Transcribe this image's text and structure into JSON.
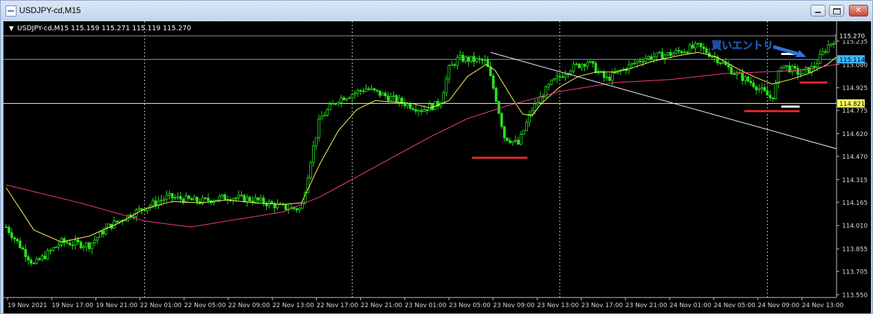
{
  "window": {
    "title": "USDJPY-cd,M15"
  },
  "chart_header": "USDJPY-cd,M15  115.159 115.271 115.119 115.270",
  "annotation": {
    "text": "買いエントリ"
  },
  "chart_data": {
    "type": "candlestick",
    "title": "USDJPY-cd,M15",
    "ylim": [
      113.55,
      115.33
    ],
    "y_ticks": [
      "115.235",
      "115.080",
      "114.925",
      "114.775",
      "114.620",
      "114.470",
      "114.315",
      "114.165",
      "114.010",
      "113.855",
      "113.705",
      "113.550"
    ],
    "x_ticks": [
      "19 Nov 2021",
      "19 Nov 17:00",
      "19 Nov 21:00",
      "22 Nov 01:00",
      "22 Nov 05:00",
      "22 Nov 09:00",
      "22 Nov 13:00",
      "22 Nov 17:00",
      "22 Nov 21:00",
      "23 Nov 01:00",
      "23 Nov 05:00",
      "23 Nov 09:00",
      "23 Nov 13:00",
      "23 Nov 17:00",
      "23 Nov 21:00",
      "24 Nov 01:00",
      "24 Nov 05:00",
      "24 Nov 09:00",
      "24 Nov 13:00"
    ],
    "last_price": "115.270",
    "h_lines": [
      {
        "price": 115.114,
        "label": "115.114",
        "color": "#3fb6ff"
      },
      {
        "price": 114.821,
        "label": "114.821",
        "color": "#ffff66"
      },
      {
        "price": 115.27,
        "label": "",
        "color": "#9a9a9a"
      }
    ],
    "price_path": [
      [
        0,
        114.0
      ],
      [
        6,
        113.75
      ],
      [
        12,
        113.9
      ],
      [
        18,
        113.88
      ],
      [
        22,
        114.0
      ],
      [
        28,
        114.1
      ],
      [
        35,
        114.2
      ],
      [
        42,
        114.17
      ],
      [
        48,
        114.2
      ],
      [
        54,
        114.18
      ],
      [
        60,
        114.13
      ],
      [
        64,
        114.12
      ],
      [
        66,
        114.45
      ],
      [
        68,
        114.72
      ],
      [
        72,
        114.85
      ],
      [
        78,
        114.92
      ],
      [
        84,
        114.85
      ],
      [
        90,
        114.78
      ],
      [
        94,
        114.82
      ],
      [
        96,
        115.05
      ],
      [
        98,
        115.12
      ],
      [
        104,
        115.1
      ],
      [
        106,
        114.88
      ],
      [
        108,
        114.6
      ],
      [
        111,
        114.55
      ],
      [
        114,
        114.78
      ],
      [
        118,
        114.95
      ],
      [
        122,
        115.05
      ],
      [
        126,
        115.1
      ],
      [
        130,
        114.98
      ],
      [
        134,
        115.05
      ],
      [
        138,
        115.12
      ],
      [
        144,
        115.15
      ],
      [
        150,
        115.2
      ],
      [
        154,
        115.12
      ],
      [
        158,
        115.02
      ],
      [
        162,
        114.95
      ],
      [
        166,
        114.85
      ],
      [
        168,
        115.08
      ],
      [
        172,
        115.02
      ],
      [
        175,
        115.06
      ],
      [
        178,
        115.2
      ],
      [
        180,
        115.26
      ]
    ],
    "series": [
      {
        "name": "",
        "color": "#ffff66",
        "points": [
          [
            0,
            114.26
          ],
          [
            6,
            113.98
          ],
          [
            12,
            113.9
          ],
          [
            18,
            113.94
          ],
          [
            24,
            114.02
          ],
          [
            30,
            114.12
          ],
          [
            36,
            114.17
          ],
          [
            42,
            114.16
          ],
          [
            48,
            114.18
          ],
          [
            54,
            114.16
          ],
          [
            60,
            114.15
          ],
          [
            64,
            114.16
          ],
          [
            68,
            114.42
          ],
          [
            72,
            114.64
          ],
          [
            76,
            114.78
          ],
          [
            80,
            114.84
          ],
          [
            84,
            114.83
          ],
          [
            88,
            114.82
          ],
          [
            92,
            114.79
          ],
          [
            96,
            114.84
          ],
          [
            100,
            115.0
          ],
          [
            104,
            115.08
          ],
          [
            106,
            115.04
          ],
          [
            108,
            114.94
          ],
          [
            110,
            114.84
          ],
          [
            112,
            114.75
          ],
          [
            114,
            114.74
          ],
          [
            116,
            114.82
          ],
          [
            120,
            114.93
          ],
          [
            124,
            115.0
          ],
          [
            128,
            115.03
          ],
          [
            132,
            115.03
          ],
          [
            136,
            115.06
          ],
          [
            140,
            115.1
          ],
          [
            146,
            115.14
          ],
          [
            150,
            115.16
          ],
          [
            154,
            115.13
          ],
          [
            158,
            115.06
          ],
          [
            162,
            115.0
          ],
          [
            166,
            114.95
          ],
          [
            170,
            114.98
          ],
          [
            174,
            115.02
          ],
          [
            178,
            115.08
          ],
          [
            180,
            115.13
          ]
        ]
      },
      {
        "name": "",
        "color": "#ff3c8c",
        "points": [
          [
            0,
            114.28
          ],
          [
            16,
            114.16
          ],
          [
            30,
            114.04
          ],
          [
            40,
            114.0
          ],
          [
            50,
            114.05
          ],
          [
            60,
            114.1
          ],
          [
            68,
            114.2
          ],
          [
            80,
            114.4
          ],
          [
            92,
            114.6
          ],
          [
            100,
            114.72
          ],
          [
            108,
            114.8
          ],
          [
            120,
            114.9
          ],
          [
            132,
            114.96
          ],
          [
            144,
            114.98
          ],
          [
            156,
            115.02
          ],
          [
            164,
            115.03
          ],
          [
            172,
            115.04
          ],
          [
            180,
            115.08
          ]
        ]
      }
    ],
    "trendline": {
      "color": "#ffffff",
      "from": [
        105,
        115.16
      ],
      "to": [
        180,
        114.52
      ]
    },
    "markers": [
      {
        "color": "#e8282b",
        "x0": 101,
        "x1": 113,
        "price": 114.46
      },
      {
        "color": "#e8282b",
        "x0": 160,
        "x1": 172,
        "price": 114.77
      },
      {
        "color": "#e8282b",
        "x0": 172,
        "x1": 178,
        "price": 114.96
      },
      {
        "color": "#ffffff",
        "x0": 168,
        "x1": 172,
        "price": 115.15
      },
      {
        "color": "#ffffff",
        "x0": 168,
        "x1": 172,
        "price": 114.8
      }
    ],
    "grid": "vertical-dotted",
    "candle_color": "#27e21d"
  }
}
